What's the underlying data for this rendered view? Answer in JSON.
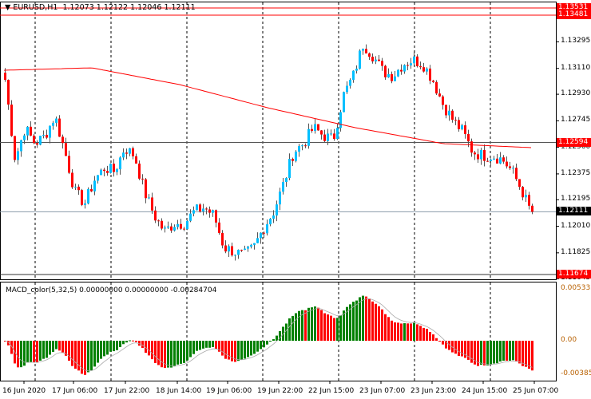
{
  "header": {
    "symbol_label": "EURUSD,H1",
    "open": "1.12073",
    "high": "1.12122",
    "low": "1.12046",
    "close": "1.12111"
  },
  "macd": {
    "label": "MACD_color(5,32,5) 0.00000000 0.00000000 -0.00284704",
    "axis": [
      "0.0053339",
      "0.00",
      "-0.003851"
    ]
  },
  "price_axis": [
    "1.13295",
    "1.13110",
    "1.12930",
    "1.12745",
    "1.12560",
    "1.12375",
    "1.12195",
    "1.12010",
    "1.11825",
    "1.11645"
  ],
  "price_tags": [
    {
      "text": "1.13531",
      "color": "#ff0000"
    },
    {
      "text": "1.13481",
      "color": "#ff0000"
    },
    {
      "text": "1.12594",
      "color": "#ff0000"
    },
    {
      "text": "1.12111",
      "color": "#000000"
    },
    {
      "text": "1.11674",
      "color": "#ff0000"
    }
  ],
  "time_axis": [
    "16 Jun 2020",
    "17 Jun 06:00",
    "17 Jun 22:00",
    "18 Jun 14:00",
    "19 Jun 06:00",
    "19 Jun 22:00",
    "22 Jun 15:00",
    "23 Jun 07:00",
    "23 Jun 23:00",
    "24 Jun 15:00",
    "25 Jun 07:00"
  ],
  "colors": {
    "bull": "#00bfff",
    "bear": "#ff0000",
    "ma": "#ff0000",
    "macd_up": "#008000",
    "macd_down": "#ff0000"
  },
  "chart_data": {
    "type": "candlestick",
    "price_range": [
      1.11674,
      1.13531
    ],
    "close_waypoints": [
      1.13031,
      1.12475,
      1.12697,
      1.12586,
      1.12641,
      1.1278,
      1.1253,
      1.12252,
      1.12169,
      1.12336,
      1.12419,
      1.12391,
      1.12558,
      1.12503,
      1.12252,
      1.12085,
      1.11974,
      1.1203,
      1.1203,
      1.12113,
      1.12141,
      1.12085,
      1.11863,
      1.11835,
      1.11807,
      1.11863,
      1.12002,
      1.12113,
      1.12308,
      1.1253,
      1.12586,
      1.12697,
      1.12641,
      1.12614,
      1.1292,
      1.13058,
      1.13281,
      1.13197,
      1.13086,
      1.13058,
      1.13142,
      1.1317,
      1.13142,
      1.13031,
      1.12864,
      1.12753,
      1.12669,
      1.1253,
      1.12503,
      1.12503,
      1.12475,
      1.12391,
      1.12252,
      1.12085
    ],
    "ma_waypoints": [
      1.13097,
      1.13114,
      1.12997,
      1.12836,
      1.12697,
      1.12586,
      1.12558
    ]
  }
}
